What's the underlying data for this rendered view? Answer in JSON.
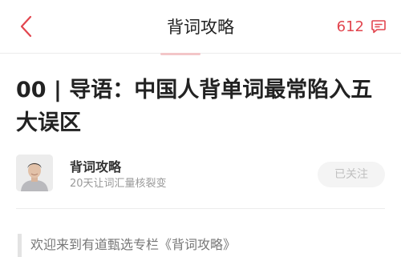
{
  "header": {
    "title": "背词攻略",
    "comment_count": "612",
    "back_icon": "chevron-left-icon",
    "comment_icon": "comment-icon",
    "accent_color": "#e2454e"
  },
  "article": {
    "title": "00 | 导语：中国人背单词最常陷入五大误区",
    "author_name": "背词攻略",
    "author_subtitle": "20天让词汇量核裂变",
    "follow_label": "已关注",
    "intro": "欢迎来到有道甄选专栏《背词攻略》"
  }
}
